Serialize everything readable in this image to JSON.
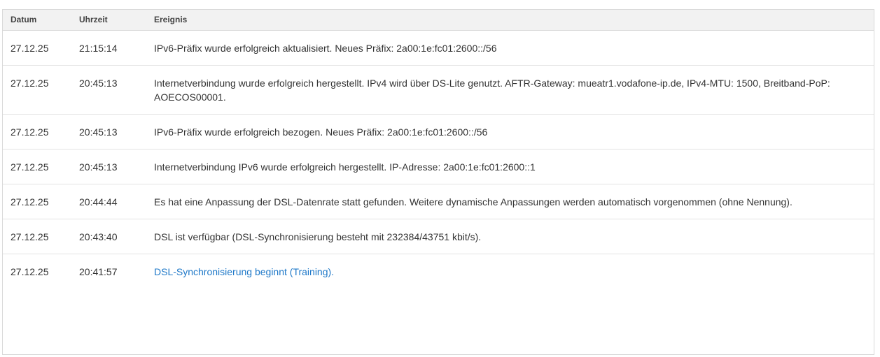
{
  "table": {
    "headers": {
      "date": "Datum",
      "time": "Uhrzeit",
      "event": "Ereignis"
    },
    "rows": [
      {
        "date": "27.12.25",
        "time": "21:15:14",
        "event": "IPv6-Präfix wurde erfolgreich aktualisiert. Neues Präfix: 2a00:1e:fc01:2600::/56"
      },
      {
        "date": "27.12.25",
        "time": "20:45:13",
        "event": "Internetverbindung wurde erfolgreich hergestellt. IPv4 wird über DS-Lite genutzt. AFTR-Gateway: mueatr1.vodafone-ip.de, IPv4-MTU: 1500, Breitband-PoP: AOECOS00001."
      },
      {
        "date": "27.12.25",
        "time": "20:45:13",
        "event": "IPv6-Präfix wurde erfolgreich bezogen. Neues Präfix: 2a00:1e:fc01:2600::/56"
      },
      {
        "date": "27.12.25",
        "time": "20:45:13",
        "event": "Internetverbindung IPv6 wurde erfolgreich hergestellt. IP-Adresse: 2a00:1e:fc01:2600::1"
      },
      {
        "date": "27.12.25",
        "time": "20:44:44",
        "event": "Es hat eine Anpassung der DSL-Datenrate statt gefunden. Weitere dynamische Anpassungen werden automatisch vorgenommen (ohne Nennung)."
      },
      {
        "date": "27.12.25",
        "time": "20:43:40",
        "event": "DSL ist verfügbar (DSL-Synchronisierung besteht mit 232384/43751 kbit/s)."
      },
      {
        "date": "27.12.25",
        "time": "20:41:57",
        "event": "DSL-Synchronisierung beginnt (Training)."
      }
    ]
  },
  "colors": {
    "link": "#1e78c8",
    "header_bg": "#f2f2f2"
  }
}
